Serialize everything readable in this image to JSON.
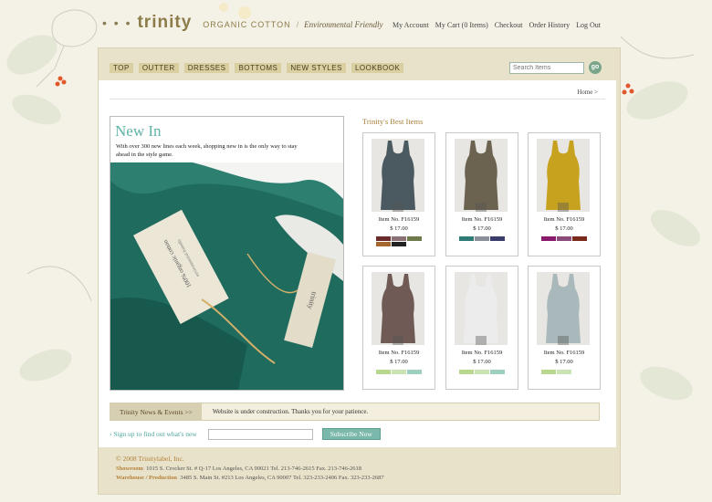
{
  "logo": {
    "dots": "• • •",
    "brand": "trinity",
    "tagline1": "ORGANIC COTTON",
    "separator": "/",
    "tagline2": "Environmental Friendly"
  },
  "account_links": [
    "My Account",
    "My Cart (0 Items)",
    "Checkout",
    "Order History",
    "Log Out"
  ],
  "nav": [
    "TOP",
    "OUTTER",
    "DRESSES",
    "BOTTOMS",
    "NEW STYLES",
    "LOOKBOOK"
  ],
  "search": {
    "placeholder": "Search Items",
    "go_label": "go"
  },
  "breadcrumb": "Home >",
  "new_in": {
    "title": "New In",
    "description": "With over 300 new lines each week, shopping new in is the only way to stay ahead in the style game.",
    "photo_tag1": "100% organic cotton",
    "photo_tag2": "environmental friendly",
    "photo_tag3": "trinity"
  },
  "best_items": {
    "title": "Trinity's Best Items",
    "products": [
      {
        "name": "Item No. F16159",
        "price": "$ 17.00",
        "garment": "#4a5a60",
        "swatches": [
          "#6b2b2b",
          "#8a6f74",
          "#6f7a4a",
          "#a5672d",
          "#222222"
        ]
      },
      {
        "name": "Item No. F16159",
        "price": "$ 17.00",
        "garment": "#6b6250",
        "swatches": [
          "#2e7a74",
          "#8b8f9a",
          "#3a3d6b"
        ]
      },
      {
        "name": "Item No. F16159",
        "price": "$ 17.00",
        "garment": "#c7a21f",
        "swatches": [
          "#8a1a6e",
          "#8a4a7a",
          "#7a2a1a"
        ]
      },
      {
        "name": "Item No. F16159",
        "price": "$ 17.00",
        "garment": "#6f5a55",
        "swatches": [
          "#b7d88e",
          "#c9e3b2",
          "#9fcfc0"
        ]
      },
      {
        "name": "Item No. F16159",
        "price": "$ 17.00",
        "garment": "#ececec",
        "swatches": [
          "#b7d88e",
          "#c9e3b2",
          "#9fcfc0"
        ]
      },
      {
        "name": "Item No. F16159",
        "price": "$ 17.00",
        "garment": "#a9b8ba",
        "swatches": [
          "#b7d88e",
          "#c9e3b2"
        ]
      }
    ]
  },
  "news": {
    "label": "Trinity News & Events  >>",
    "message": "Website is under construction. Thanks you for your patience."
  },
  "signup": {
    "label": "› Sign up to find out what's new",
    "button": "Subscribe Now"
  },
  "footer": {
    "copyright": "© 2008 Trinitylabel, Inc.",
    "showroom_label": "Showroom",
    "showroom_text": "1015 S. Crocker St. # Q-17 Los Angeles, CA 90021 Tel. 213-746-2615   Fax. 213-746-2618",
    "warehouse_label": "Warehouse / Production",
    "warehouse_text": "3485 S. Main St. #213 Los Angeles, CA 90007 Tel. 323-233-2406   Fax. 323-233-2687"
  },
  "colors": {
    "accent_teal": "#5fb3a7",
    "nav_bg": "#d9cfa0",
    "frame_bg": "#e7e2c9",
    "footer_gold": "#b4803a"
  }
}
